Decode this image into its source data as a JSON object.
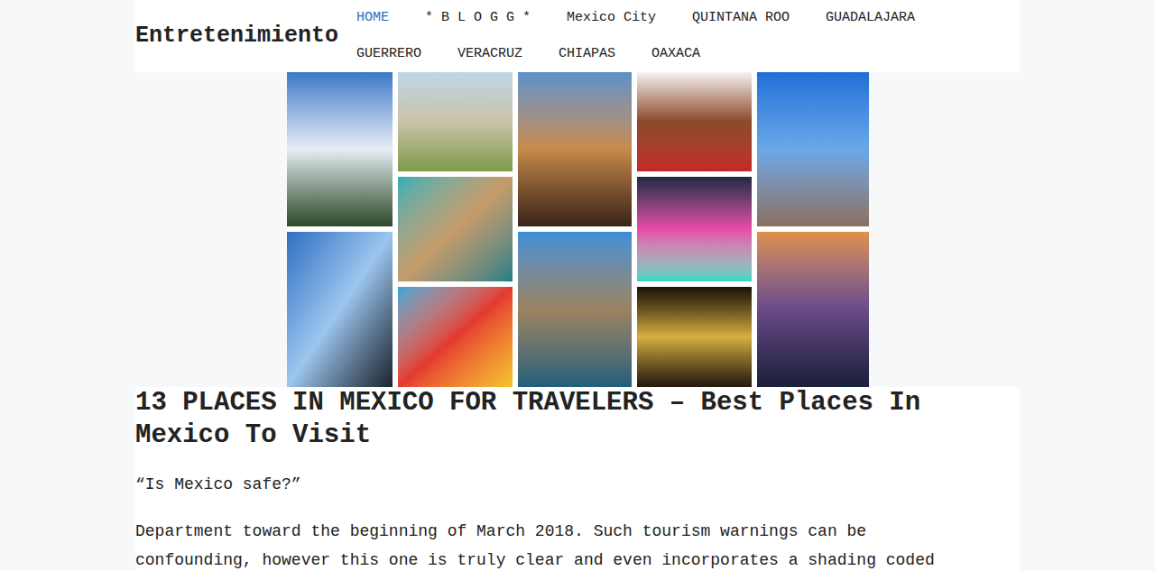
{
  "site": {
    "title": "Entretenimiento"
  },
  "nav": [
    {
      "label": "HOME",
      "selected": true
    },
    {
      "label": "* B L O G G *",
      "selected": false
    },
    {
      "label": "Mexico City",
      "selected": false
    },
    {
      "label": "QUINTANA ROO",
      "selected": false
    },
    {
      "label": "GUADALAJARA",
      "selected": false
    },
    {
      "label": "GUERRERO",
      "selected": false
    },
    {
      "label": "VERACRUZ",
      "selected": false
    },
    {
      "label": "CHIAPAS",
      "selected": false
    },
    {
      "label": "OAXACA",
      "selected": false
    }
  ],
  "article": {
    "title": "13 PLACES IN MEXICO FOR TRAVELERS – Best Places In Mexico To Visit",
    "subtitle": "“Is Mexico safe?”",
    "paragraph": "Department toward the beginning of March 2018. Such tourism warnings can be confounding, however this one is truly clear and even incorporates a shading coded"
  }
}
